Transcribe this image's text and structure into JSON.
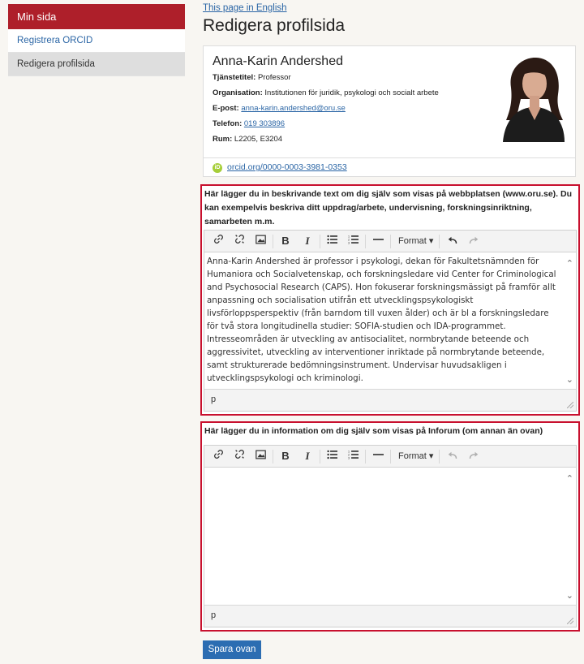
{
  "sidebar": {
    "heading": "Min sida",
    "items": [
      {
        "label": "Registrera ORCID"
      },
      {
        "label": "Redigera profilsida"
      }
    ]
  },
  "header": {
    "lang_link": "This page in English",
    "title": "Redigera profilsida"
  },
  "profile": {
    "name": "Anna-Karin Andershed",
    "title_label": "Tjänstetitel:",
    "title_value": "Professor",
    "org_label": "Organisation:",
    "org_value": "Institutionen för juridik, psykologi och socialt arbete",
    "email_label": "E-post:",
    "email_value": "anna-karin.andershed@oru.se",
    "phone_label": "Telefon:",
    "phone_value": "019 303896",
    "room_label": "Rum:",
    "room_value": "L2205, E3204",
    "orcid_link": "orcid.org/0000-0003-3981-0353",
    "orcid_icon_text": "iD"
  },
  "editor1": {
    "label": "Här lägger du in beskrivande text om dig själv som visas på webbplatsen (www.oru.se). Du kan exempelvis beskriva ditt uppdrag/arbete, undervisning, forskningsinriktning, samarbeten m.m.",
    "content": "Anna-Karin Andershed är professor i psykologi, dekan för Fakultetsnämnden för Humaniora och Socialvetenskap, och forskningsledare vid Center for Criminological and Psychosocial Research (CAPS). Hon fokuserar forskningsmässigt på framför allt anpassning och socialisation utifrån ett utvecklingspsykologiskt livsförloppsperspektiv (från barndom till vuxen ålder) och är bl a forskningsledare för två stora longitudinella studier: SOFIA-studien och IDA-programmet. Intresseområden är utveckling av antisocialitet, normbrytande beteende och aggressivitet, utveckling av interventioner inriktade på normbrytande beteende, samt strukturerade bedömningsinstrument. Undervisar huvudsakligen i utvecklingspsykologi och kriminologi.",
    "status_path": "p"
  },
  "editor2": {
    "label": "Här lägger du in information om dig själv som visas på Inforum (om annan än ovan)",
    "content": "",
    "status_path": "p"
  },
  "toolbar": {
    "format_label": "Format",
    "icons": [
      "link-icon",
      "unlink-icon",
      "image-icon",
      "bold-icon",
      "italic-icon",
      "bullet-list-icon",
      "numbered-list-icon",
      "horizontal-rule-icon",
      "undo-icon",
      "redo-icon"
    ]
  },
  "save_button": "Spara ovan",
  "colors": {
    "accent_red": "#ae1f2a",
    "section_border": "#c8102e",
    "link_blue": "#2a65a5",
    "button_blue": "#2c6db2"
  }
}
